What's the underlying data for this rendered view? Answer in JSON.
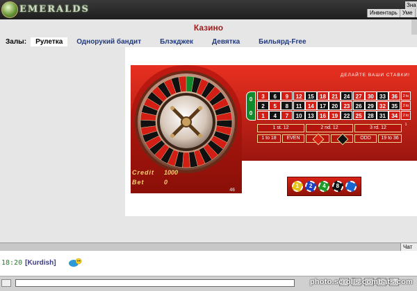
{
  "app": {
    "logo_text": "EMERALDS",
    "top_right": "Зна",
    "top_menu": [
      "Инвентарь",
      "Уме"
    ]
  },
  "page": {
    "title": "Казино"
  },
  "tabs": {
    "label": "Залы:",
    "items": [
      "Рулетка",
      "Однорукий бандит",
      "Блэкджек",
      "Девятка",
      "Бильярд-Free"
    ],
    "active_index": 0
  },
  "roulette": {
    "header": "ДЕЛАЙТЕ ВАШИ СТАВКИ!",
    "zero_labels": [
      "0",
      "0"
    ],
    "grid_rows": [
      [
        "3",
        "6",
        "9",
        "12",
        "15",
        "18",
        "21",
        "24",
        "27",
        "30",
        "33",
        "36"
      ],
      [
        "2",
        "5",
        "8",
        "11",
        "14",
        "17",
        "20",
        "23",
        "26",
        "29",
        "32",
        "35"
      ],
      [
        "1",
        "4",
        "7",
        "10",
        "13",
        "16",
        "19",
        "22",
        "25",
        "28",
        "31",
        "34"
      ]
    ],
    "column_bets": [
      "2 to 1",
      "2 to 1",
      "2 to 1"
    ],
    "dozens": [
      "1 st. 12",
      "2 nd. 12",
      "3 rd. 12"
    ],
    "outside": [
      "1 to 18",
      "EVEN",
      "ODD",
      "19 to 36"
    ],
    "credit_label": "Credit",
    "credit_value": "1000",
    "bet_label": "Bet",
    "bet_value": "0",
    "corner_number": "46",
    "chips": [
      {
        "label": "1",
        "color": "#e6c31a"
      },
      {
        "label": "2",
        "color": "#1d3fc6"
      },
      {
        "label": "4",
        "color": "#1f9a2a"
      },
      {
        "label": "8",
        "color": "#111111"
      },
      {
        "label": "",
        "color": "#1a64d0"
      }
    ]
  },
  "bottom": {
    "chat_tab": "Чат",
    "message_time": "18:20",
    "message_user": "[Kurdish]",
    "watermark": "photo.scrolls.combats.com"
  },
  "colors": {
    "red": "#d31e16",
    "black": "#111111",
    "green": "#118a2c",
    "title": "#9c1c1c",
    "tab_link": "#223a7c"
  }
}
